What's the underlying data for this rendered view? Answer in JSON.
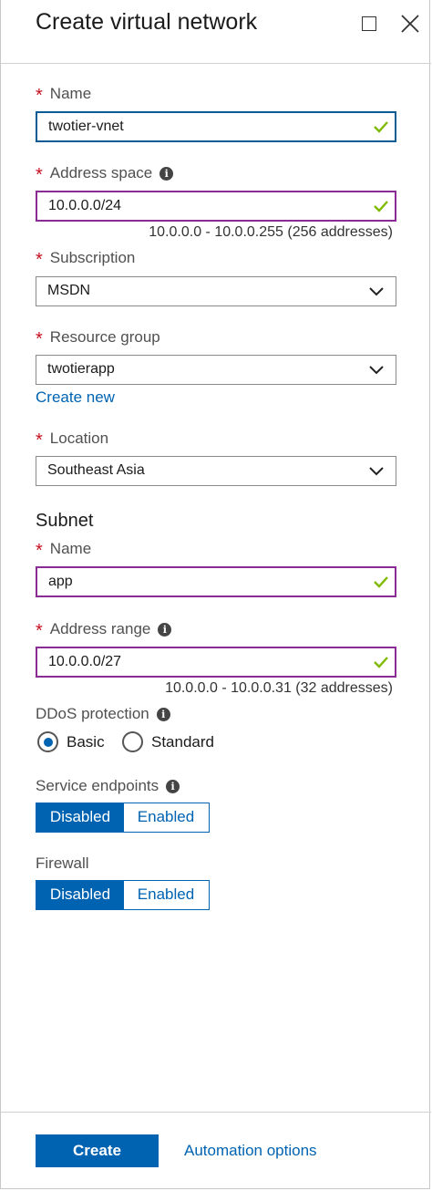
{
  "blade": {
    "title": "Create virtual network"
  },
  "form": {
    "name": {
      "label": "Name",
      "value": "twotier-vnet"
    },
    "address_space": {
      "label": "Address space",
      "value": "10.0.0.0/24",
      "hint": "10.0.0.0 - 10.0.0.255 (256 addresses)"
    },
    "subscription": {
      "label": "Subscription",
      "value": "MSDN"
    },
    "resource_group": {
      "label": "Resource group",
      "value": "twotierapp",
      "create_new_link": "Create new"
    },
    "location": {
      "label": "Location",
      "value": "Southeast Asia"
    }
  },
  "subnet": {
    "section_title": "Subnet",
    "name": {
      "label": "Name",
      "value": "app"
    },
    "address_range": {
      "label": "Address range",
      "value": "10.0.0.0/27",
      "hint": "10.0.0.0 - 10.0.0.31 (32 addresses)"
    }
  },
  "ddos": {
    "label": "DDoS protection",
    "options": [
      "Basic",
      "Standard"
    ],
    "selected": "Basic"
  },
  "service_endpoints": {
    "label": "Service endpoints",
    "options": [
      "Disabled",
      "Enabled"
    ],
    "selected": "Disabled"
  },
  "firewall": {
    "label": "Firewall",
    "options": [
      "Disabled",
      "Enabled"
    ],
    "selected": "Disabled"
  },
  "footer": {
    "create_label": "Create",
    "automation_label": "Automation options"
  },
  "colors": {
    "accent": "#0063b1",
    "required": "#c50f1f",
    "valid_check": "#7fba00",
    "valid_border": "#8a2c93",
    "focus_border": "#0a5a94"
  },
  "icons": {
    "maximize": "maximize-icon",
    "close": "close-icon",
    "info": "info-icon",
    "check": "checkmark-icon",
    "dropdown": "chevron-down-icon"
  }
}
